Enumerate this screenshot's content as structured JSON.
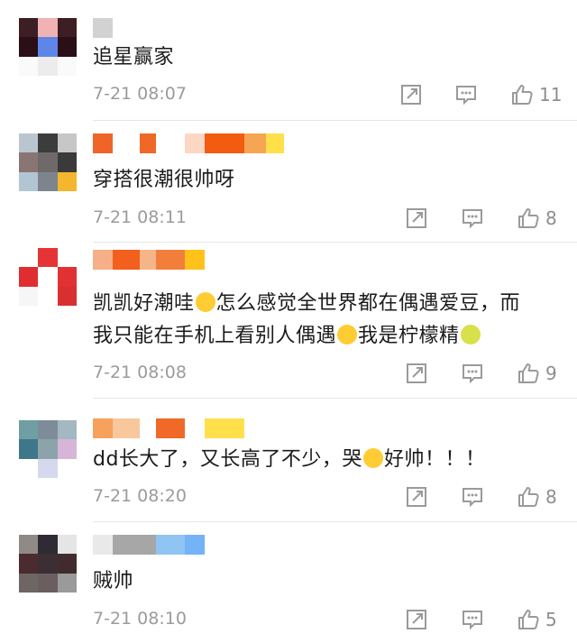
{
  "comments": [
    {
      "text": "追星赢家",
      "time": "7-21 08:07",
      "likes": "11",
      "avatar": [
        "#3d1e24",
        "#f0b2b2",
        "#3d1e24",
        "#2a0f17",
        "#5e86e8",
        "#2a0f17",
        "#fafafa",
        "#ececec",
        "#fafafa"
      ],
      "name_blocks": [
        "#d2d2d2"
      ]
    },
    {
      "text": "穿搭很潮很帅呀",
      "time": "7-21 08:11",
      "likes": "8",
      "avatar": [
        "#b9c6d0",
        "#3c3c3c",
        "#c7c7c7",
        "#8a7575",
        "#6f6969",
        "#3a3a3a",
        "#b2c5d3",
        "#7d848e",
        "#f3b62c"
      ],
      "name_blocks": [
        "#f0642a",
        "#ffffff",
        "#f06826",
        "#ffffff",
        "#fbd7c4",
        "#f25b10",
        "#f6a552",
        "#ffe04b"
      ]
    },
    {
      "text_line1_a": "凯凯好潮哇",
      "text_line1_b": "怎么感觉全世界都在偶遇爱豆，而",
      "text_line2_a": "我只能在手机上看别人偶遇",
      "text_line2_b": "我是柠檬精",
      "time": "7-21 08:08",
      "likes": "9",
      "avatar": [
        "#ffffff",
        "#e53435",
        "#ffffff",
        "#e02d2f",
        "#ffffff",
        "#e13133",
        "#f6f6f6",
        "#ffffff",
        "#d83030"
      ],
      "name_blocks": [
        "#f6af86",
        "#f35f1c",
        "#f6b588",
        "#f27e3c",
        "#ffc21a"
      ]
    },
    {
      "text": "dd长大了，又长高了不少，哭",
      "text_b": "好帅！！！",
      "time": "7-21 08:20",
      "likes": "8",
      "avatar": [
        "#6f9ea3",
        "#7e8c9a",
        "#a3b8c0",
        "#3d7789",
        "#8ca3ab",
        "#d6b5d8",
        "#ffffff",
        "#d6d9ee",
        "#ffffff"
      ],
      "name_blocks": [
        "#f6a25c",
        "#f9c79c",
        "#ffffff",
        "#f06928",
        "#ffffff",
        "#ffe04b"
      ]
    },
    {
      "text": "贼帅",
      "time": "7-21 08:10",
      "likes": "5",
      "avatar": [
        "#8f8a86",
        "#2f2a33",
        "#e5e5e5",
        "#4b2b2f",
        "#3c2f33",
        "#422b2f",
        "#6e6565",
        "#6b5e5e",
        "#9a9a9a"
      ],
      "name_blocks": [
        "#e9e9e9",
        "#a7a7a7",
        "#a6a6a6",
        "#8fc4f3",
        "#74b3f6"
      ]
    }
  ],
  "icons": {
    "share": "share-icon",
    "comment": "comment-icon",
    "like": "thumbs-up-icon"
  }
}
